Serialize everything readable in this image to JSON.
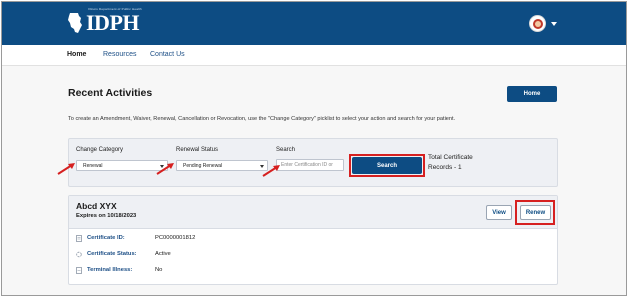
{
  "header": {
    "logo_text": "IDPH",
    "logo_subtext": "Illinois Department of Public Health",
    "avatar_icon": "user-avatar-icon",
    "menu_caret_icon": "chevron-down-icon"
  },
  "nav": {
    "items": [
      {
        "label": "Home",
        "active": true
      },
      {
        "label": "Resources",
        "active": false
      },
      {
        "label": "Contact Us",
        "active": false
      }
    ]
  },
  "main": {
    "title": "Recent Activities",
    "home_button": "Home",
    "instructions": "To create an Amendment, Waiver, Renewal, Cancellation or Revocation, use the \"Change Category\" picklist to select your action and search for your patient."
  },
  "filters": {
    "change_category": {
      "label": "Change Category",
      "value": "Renewal"
    },
    "renewal_status": {
      "label": "Renewal Status",
      "value": "Pending Renewal"
    },
    "search": {
      "label": "Search",
      "placeholder": "Enter Certification ID or"
    },
    "search_button": "Search",
    "total_line1": "Total Certificate",
    "total_line2": "Records - 1"
  },
  "record": {
    "name": "Abcd XYX",
    "expires": "Expires on 10/18/2023",
    "view_button": "View",
    "renew_button": "Renew",
    "fields": [
      {
        "key": "Certificate ID:",
        "value": "PC0000001812",
        "icon": "certificate-icon"
      },
      {
        "key": "Certificate Status:",
        "value": "Active",
        "icon": "status-icon"
      },
      {
        "key": "Terminal Illness:",
        "value": "No",
        "icon": "document-icon"
      }
    ]
  },
  "colors": {
    "brand": "#0d4c83",
    "highlight": "#d62020",
    "card_bg": "#eef0f4"
  }
}
